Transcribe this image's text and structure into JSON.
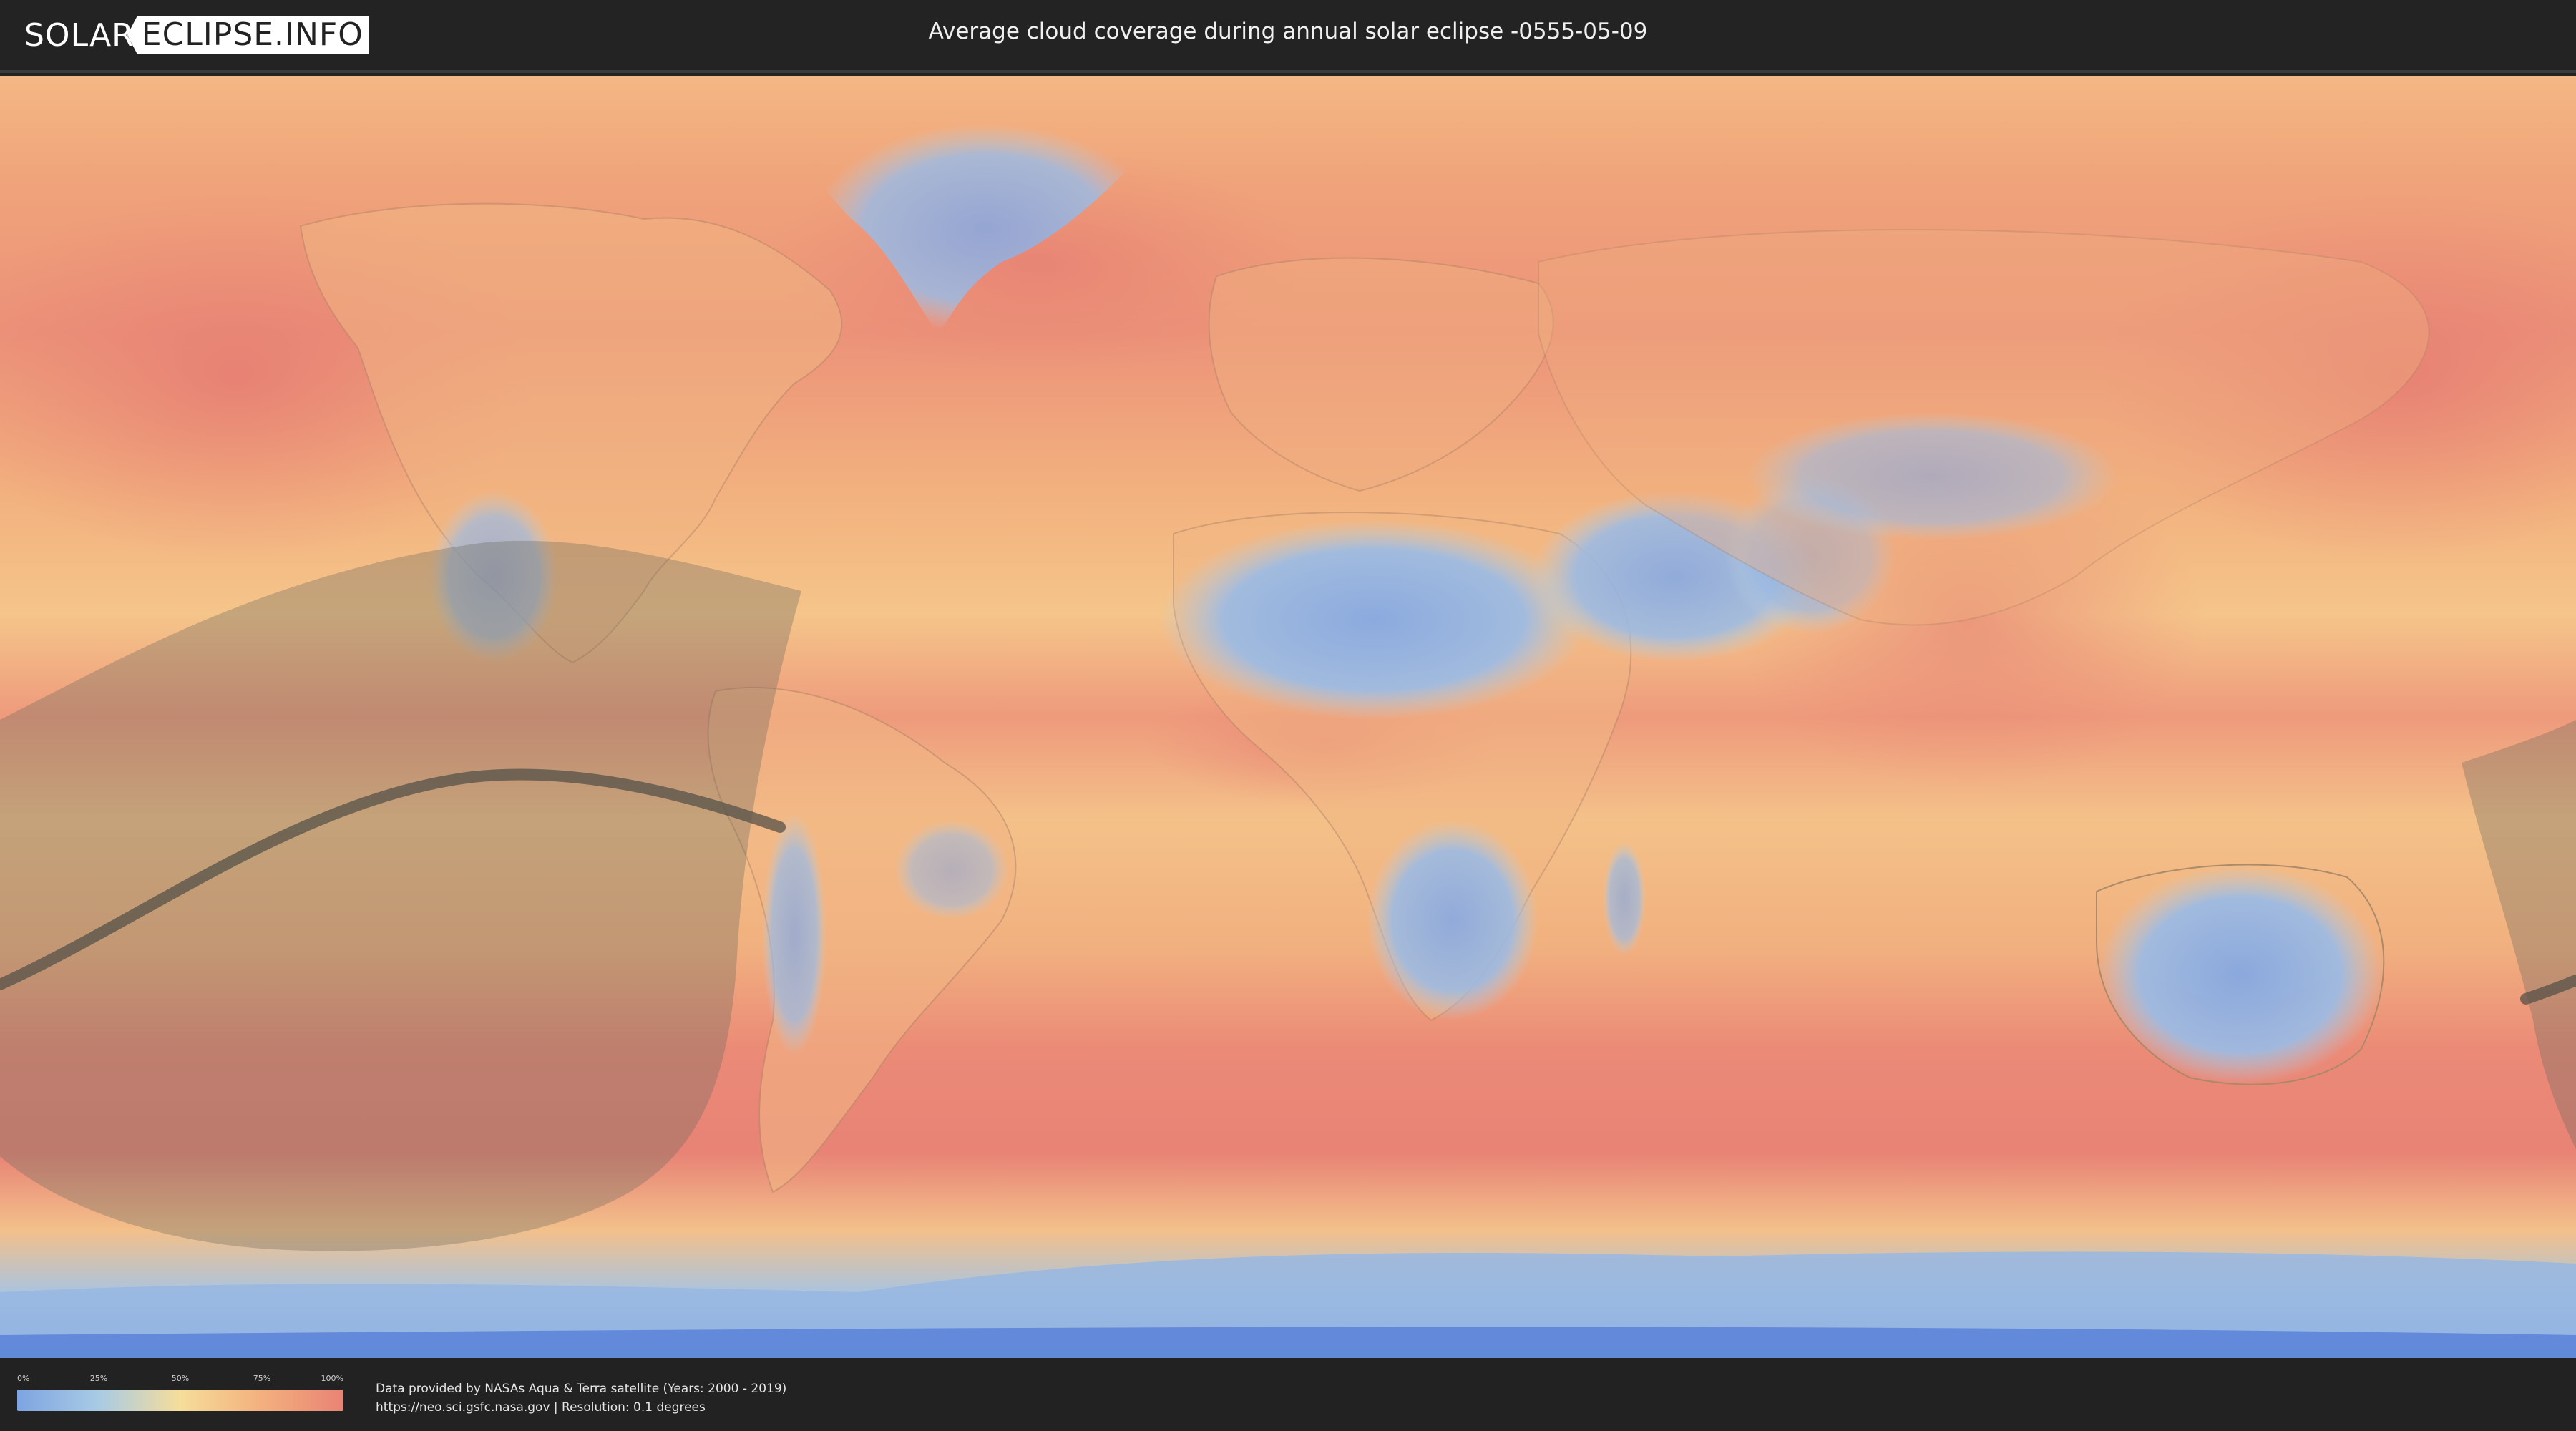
{
  "header": {
    "logo_left": "SOLAR",
    "logo_right": "ECLIPSE.INFO",
    "title": "Average cloud coverage during annual solar eclipse -0555-05-09"
  },
  "map": {
    "colors": {
      "ocean_high": "#e98374",
      "ocean_mid": "#f2ae7c",
      "mid": "#f6c987",
      "low": "#a8c5e2",
      "clear": "#7ea4e2",
      "eclipse_shadow": "#6c6a5e"
    }
  },
  "legend": {
    "ticks": [
      "0%",
      "25%",
      "50%",
      "75%",
      "100%"
    ],
    "gradient": [
      "#7ea4e2",
      "#a8cbe4",
      "#f6dd9a",
      "#f3b07e",
      "#e98374"
    ]
  },
  "credits": {
    "line1": "Data provided by NASAs Aqua & Terra satellite (Years: 2000 - 2019)",
    "line2": "https://neo.sci.gsfc.nasa.gov | Resolution: 0.1 degrees"
  }
}
